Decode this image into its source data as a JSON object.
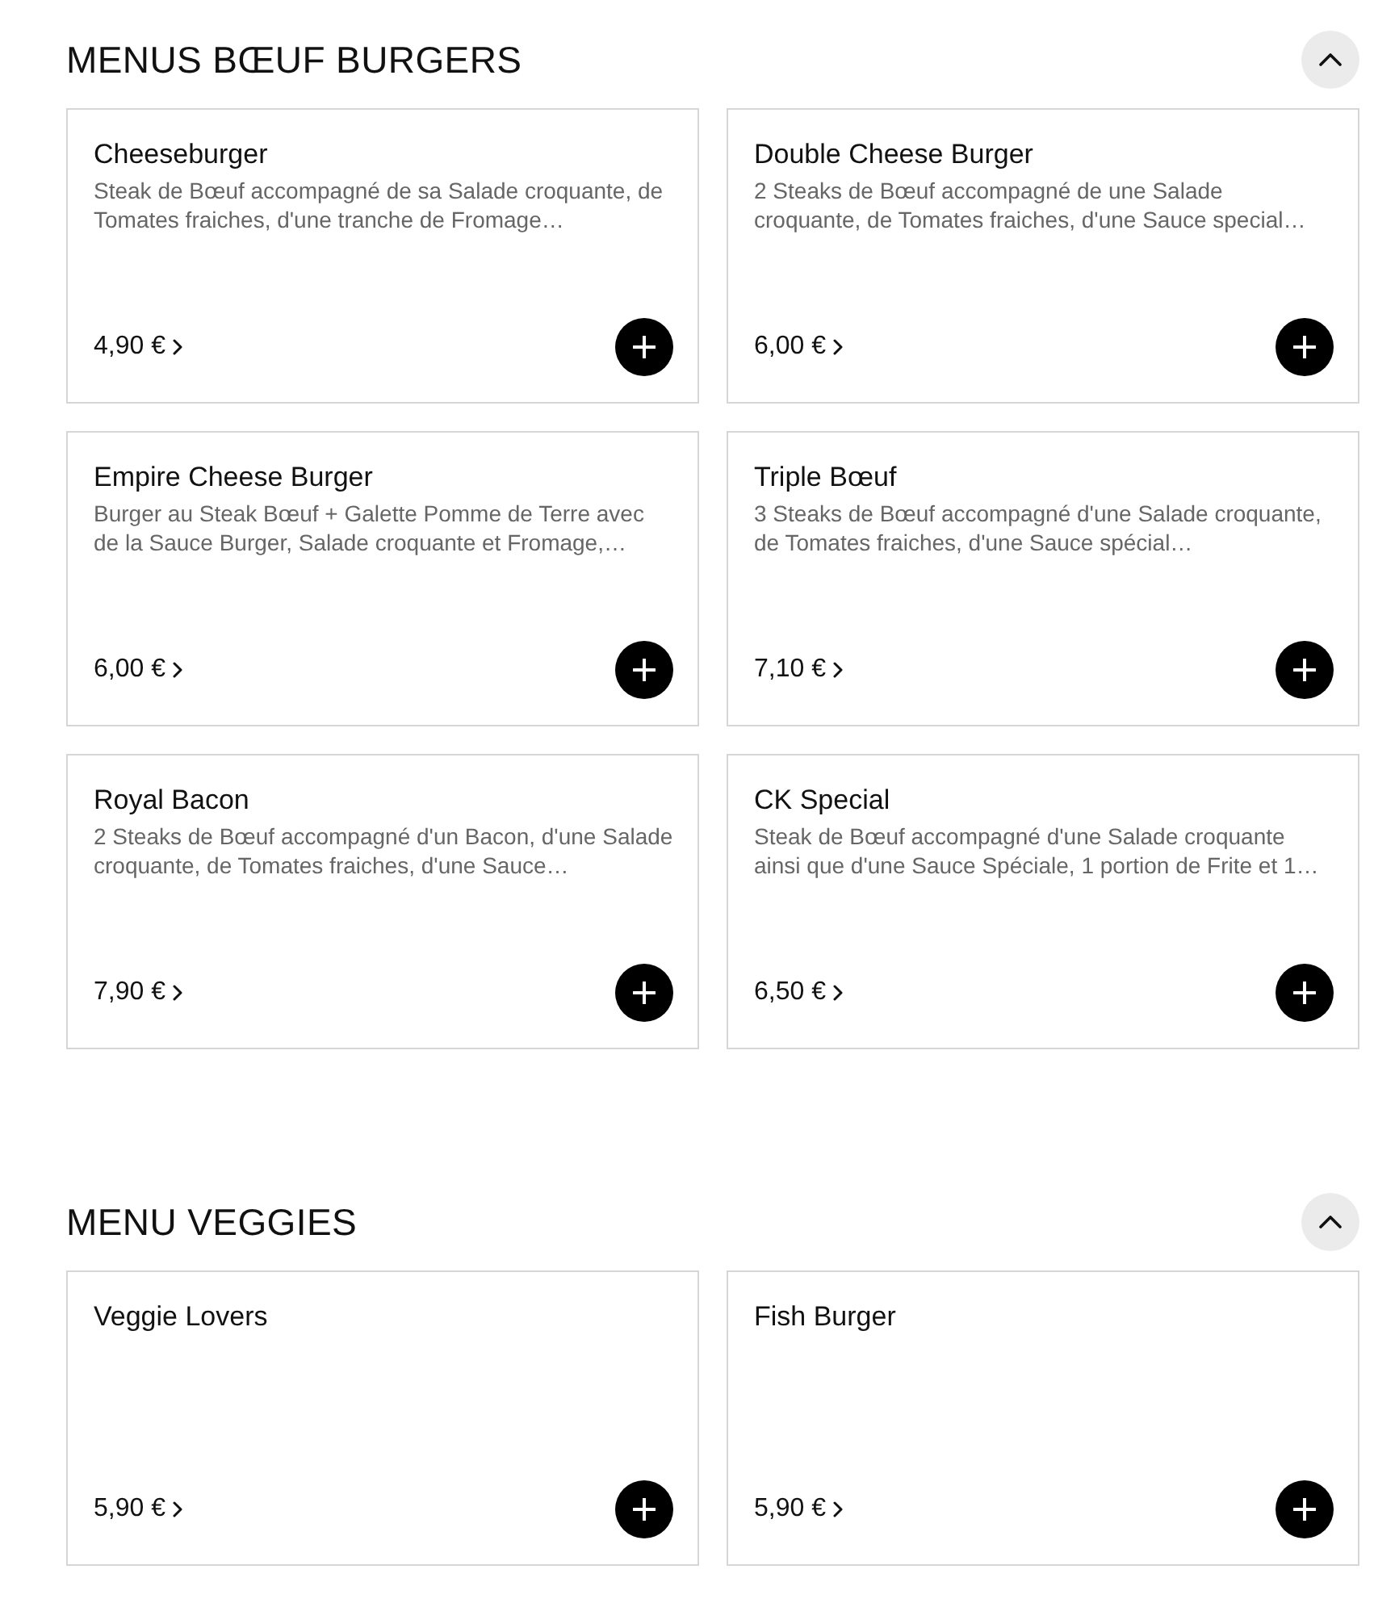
{
  "sections": [
    {
      "title": "MENUS BŒUF BURGERS",
      "expanded": true,
      "items": [
        {
          "name": "Cheeseburger",
          "description": "Steak de Bœuf accompagné de sa Salade croquante, de Tomates fraiches, d'une tranche de Fromage…",
          "price": "4,90 €"
        },
        {
          "name": "Double Cheese Burger",
          "description": "2 Steaks de Bœuf accompagné de une Salade croquante, de Tomates fraiches, d'une Sauce special…",
          "price": "6,00 €"
        },
        {
          "name": "Empire Cheese Burger",
          "description": "Burger au Steak Bœuf + Galette Pomme de Terre avec de la Sauce Burger, Salade croquante et Fromage,…",
          "price": "6,00 €"
        },
        {
          "name": "Triple Bœuf",
          "description": "3 Steaks de Bœuf accompagné d'une Salade croquante, de Tomates fraiches, d'une Sauce spécial…",
          "price": "7,10 €"
        },
        {
          "name": "Royal Bacon",
          "description": "2 Steaks de Bœuf accompagné d'un Bacon, d'une Salade croquante, de Tomates fraiches, d'une Sauce…",
          "price": "7,90 €"
        },
        {
          "name": "CK Special",
          "description": "Steak de Bœuf accompagné d'une Salade croquante ainsi que d'une Sauce Spéciale, 1 portion de Frite et 1…",
          "price": "6,50 €"
        }
      ]
    },
    {
      "title": "MENU VEGGIES",
      "expanded": true,
      "items": [
        {
          "name": "Veggie Lovers",
          "price": "5,90 €"
        },
        {
          "name": "Fish Burger",
          "price": "5,90 €"
        }
      ]
    }
  ]
}
